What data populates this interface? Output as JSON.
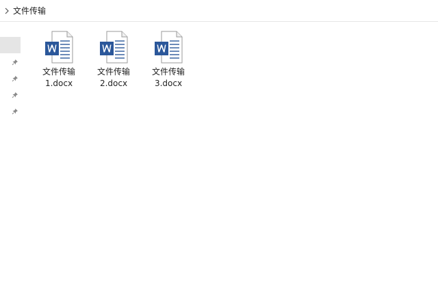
{
  "address_bar": {
    "breadcrumb": "文件传输"
  },
  "nav_pane": {
    "pinned_count": 4,
    "icon": "pin-icon"
  },
  "files": [
    {
      "name_line1": "文件传输",
      "name_line2": "1.docx",
      "icon": "word-document-icon"
    },
    {
      "name_line1": "文件传输",
      "name_line2": "2.docx",
      "icon": "word-document-icon"
    },
    {
      "name_line1": "文件传输",
      "name_line2": "3.docx",
      "icon": "word-document-icon"
    }
  ],
  "colors": {
    "word_blue": "#2b579a",
    "text": "#1f1f1f"
  }
}
